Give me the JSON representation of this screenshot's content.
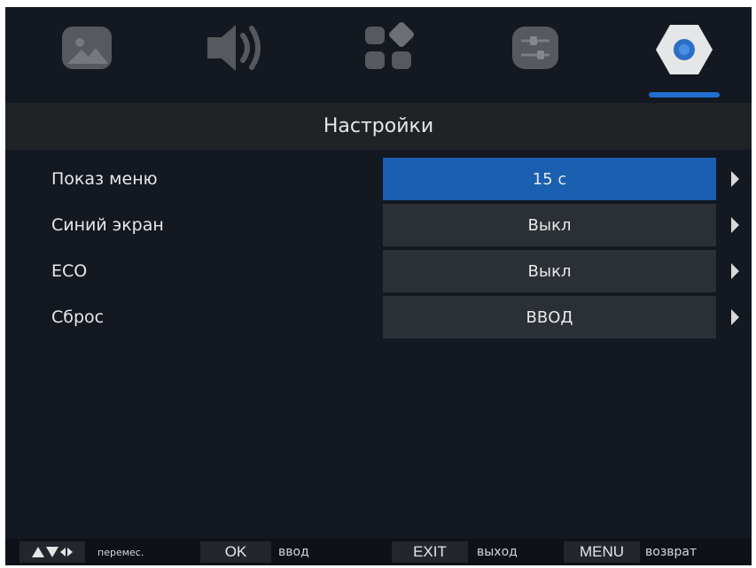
{
  "tabs": [
    {
      "icon": "picture-icon",
      "active": false
    },
    {
      "icon": "sound-icon",
      "active": false
    },
    {
      "icon": "apps-icon",
      "active": false
    },
    {
      "icon": "sliders-icon",
      "active": false
    },
    {
      "icon": "settings-gear-icon",
      "active": true
    }
  ],
  "title": "Настройки",
  "rows": [
    {
      "label": "Показ меню",
      "value": "15 с",
      "selected": true
    },
    {
      "label": "Синий экран",
      "value": "Выкл",
      "selected": false
    },
    {
      "label": "ECO",
      "value": "Выкл",
      "selected": false
    },
    {
      "label": "Сброс",
      "value": "ВВОД",
      "selected": false
    }
  ],
  "footer": {
    "nav_hint": "перемес.",
    "ok_key": "OK",
    "ok_hint": "ввод",
    "exit_key": "EXIT",
    "exit_hint": "выход",
    "menu_key": "MENU",
    "menu_hint": "возврат"
  },
  "colors": {
    "background": "#131821",
    "selected": "#1a5fb0",
    "value_box": "#2b2f36",
    "accent": "#1f6fd0"
  }
}
